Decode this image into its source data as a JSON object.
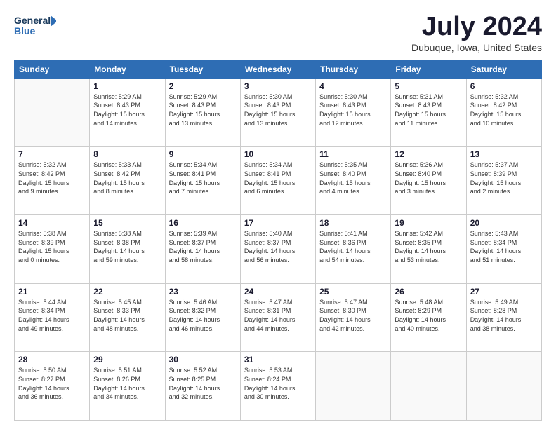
{
  "logo": {
    "line1": "General",
    "line2": "Blue"
  },
  "header": {
    "month": "July 2024",
    "location": "Dubuque, Iowa, United States"
  },
  "weekdays": [
    "Sunday",
    "Monday",
    "Tuesday",
    "Wednesday",
    "Thursday",
    "Friday",
    "Saturday"
  ],
  "weeks": [
    [
      {
        "day": "",
        "info": ""
      },
      {
        "day": "1",
        "info": "Sunrise: 5:29 AM\nSunset: 8:43 PM\nDaylight: 15 hours\nand 14 minutes."
      },
      {
        "day": "2",
        "info": "Sunrise: 5:29 AM\nSunset: 8:43 PM\nDaylight: 15 hours\nand 13 minutes."
      },
      {
        "day": "3",
        "info": "Sunrise: 5:30 AM\nSunset: 8:43 PM\nDaylight: 15 hours\nand 13 minutes."
      },
      {
        "day": "4",
        "info": "Sunrise: 5:30 AM\nSunset: 8:43 PM\nDaylight: 15 hours\nand 12 minutes."
      },
      {
        "day": "5",
        "info": "Sunrise: 5:31 AM\nSunset: 8:43 PM\nDaylight: 15 hours\nand 11 minutes."
      },
      {
        "day": "6",
        "info": "Sunrise: 5:32 AM\nSunset: 8:42 PM\nDaylight: 15 hours\nand 10 minutes."
      }
    ],
    [
      {
        "day": "7",
        "info": "Sunrise: 5:32 AM\nSunset: 8:42 PM\nDaylight: 15 hours\nand 9 minutes."
      },
      {
        "day": "8",
        "info": "Sunrise: 5:33 AM\nSunset: 8:42 PM\nDaylight: 15 hours\nand 8 minutes."
      },
      {
        "day": "9",
        "info": "Sunrise: 5:34 AM\nSunset: 8:41 PM\nDaylight: 15 hours\nand 7 minutes."
      },
      {
        "day": "10",
        "info": "Sunrise: 5:34 AM\nSunset: 8:41 PM\nDaylight: 15 hours\nand 6 minutes."
      },
      {
        "day": "11",
        "info": "Sunrise: 5:35 AM\nSunset: 8:40 PM\nDaylight: 15 hours\nand 4 minutes."
      },
      {
        "day": "12",
        "info": "Sunrise: 5:36 AM\nSunset: 8:40 PM\nDaylight: 15 hours\nand 3 minutes."
      },
      {
        "day": "13",
        "info": "Sunrise: 5:37 AM\nSunset: 8:39 PM\nDaylight: 15 hours\nand 2 minutes."
      }
    ],
    [
      {
        "day": "14",
        "info": "Sunrise: 5:38 AM\nSunset: 8:39 PM\nDaylight: 15 hours\nand 0 minutes."
      },
      {
        "day": "15",
        "info": "Sunrise: 5:38 AM\nSunset: 8:38 PM\nDaylight: 14 hours\nand 59 minutes."
      },
      {
        "day": "16",
        "info": "Sunrise: 5:39 AM\nSunset: 8:37 PM\nDaylight: 14 hours\nand 58 minutes."
      },
      {
        "day": "17",
        "info": "Sunrise: 5:40 AM\nSunset: 8:37 PM\nDaylight: 14 hours\nand 56 minutes."
      },
      {
        "day": "18",
        "info": "Sunrise: 5:41 AM\nSunset: 8:36 PM\nDaylight: 14 hours\nand 54 minutes."
      },
      {
        "day": "19",
        "info": "Sunrise: 5:42 AM\nSunset: 8:35 PM\nDaylight: 14 hours\nand 53 minutes."
      },
      {
        "day": "20",
        "info": "Sunrise: 5:43 AM\nSunset: 8:34 PM\nDaylight: 14 hours\nand 51 minutes."
      }
    ],
    [
      {
        "day": "21",
        "info": "Sunrise: 5:44 AM\nSunset: 8:34 PM\nDaylight: 14 hours\nand 49 minutes."
      },
      {
        "day": "22",
        "info": "Sunrise: 5:45 AM\nSunset: 8:33 PM\nDaylight: 14 hours\nand 48 minutes."
      },
      {
        "day": "23",
        "info": "Sunrise: 5:46 AM\nSunset: 8:32 PM\nDaylight: 14 hours\nand 46 minutes."
      },
      {
        "day": "24",
        "info": "Sunrise: 5:47 AM\nSunset: 8:31 PM\nDaylight: 14 hours\nand 44 minutes."
      },
      {
        "day": "25",
        "info": "Sunrise: 5:47 AM\nSunset: 8:30 PM\nDaylight: 14 hours\nand 42 minutes."
      },
      {
        "day": "26",
        "info": "Sunrise: 5:48 AM\nSunset: 8:29 PM\nDaylight: 14 hours\nand 40 minutes."
      },
      {
        "day": "27",
        "info": "Sunrise: 5:49 AM\nSunset: 8:28 PM\nDaylight: 14 hours\nand 38 minutes."
      }
    ],
    [
      {
        "day": "28",
        "info": "Sunrise: 5:50 AM\nSunset: 8:27 PM\nDaylight: 14 hours\nand 36 minutes."
      },
      {
        "day": "29",
        "info": "Sunrise: 5:51 AM\nSunset: 8:26 PM\nDaylight: 14 hours\nand 34 minutes."
      },
      {
        "day": "30",
        "info": "Sunrise: 5:52 AM\nSunset: 8:25 PM\nDaylight: 14 hours\nand 32 minutes."
      },
      {
        "day": "31",
        "info": "Sunrise: 5:53 AM\nSunset: 8:24 PM\nDaylight: 14 hours\nand 30 minutes."
      },
      {
        "day": "",
        "info": ""
      },
      {
        "day": "",
        "info": ""
      },
      {
        "day": "",
        "info": ""
      }
    ]
  ]
}
